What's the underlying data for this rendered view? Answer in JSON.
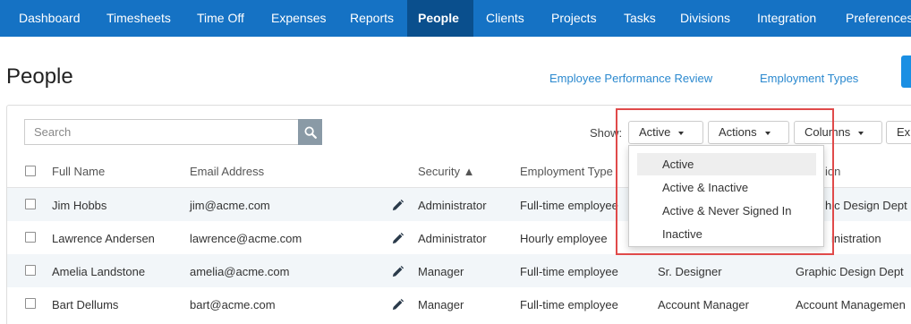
{
  "nav": {
    "items": [
      {
        "label": "Dashboard"
      },
      {
        "label": "Timesheets"
      },
      {
        "label": "Time Off"
      },
      {
        "label": "Expenses"
      },
      {
        "label": "Reports"
      },
      {
        "label": "People"
      },
      {
        "label": "Clients"
      },
      {
        "label": "Projects"
      },
      {
        "label": "Tasks"
      },
      {
        "label": "Divisions"
      },
      {
        "label": "Integration"
      },
      {
        "label": "Preferences"
      }
    ],
    "active": "People"
  },
  "header": {
    "title": "People",
    "links": [
      {
        "label": "Employee Performance Review"
      },
      {
        "label": "Employment Types"
      }
    ]
  },
  "toolbar": {
    "search_placeholder": "Search",
    "show_label": "Show:",
    "filter_value": "Active",
    "actions_label": "Actions",
    "columns_label": "Columns",
    "export_label": "Ex"
  },
  "filter_menu": {
    "options": [
      "Active",
      "Active & Inactive",
      "Active & Never Signed In",
      "Inactive"
    ],
    "selected": "Active"
  },
  "table": {
    "columns": {
      "full_name": "Full Name",
      "email": "Email Address",
      "security": "Security ▲",
      "employment_type": "Employment Type",
      "division_partial": "ion"
    },
    "rows": [
      {
        "name": "Jim Hobbs",
        "email": "jim@acme.com",
        "security": "Administrator",
        "employment_type": "Full-time employee",
        "title": "",
        "division": "hic Design Dept"
      },
      {
        "name": "Lawrence Andersen",
        "email": "lawrence@acme.com",
        "security": "Administrator",
        "employment_type": "Hourly employee",
        "title": "",
        "division": "inistration"
      },
      {
        "name": "Amelia Landstone",
        "email": "amelia@acme.com",
        "security": "Manager",
        "employment_type": "Full-time employee",
        "title": "Sr. Designer",
        "division": "Graphic Design Dept"
      },
      {
        "name": "Bart Dellums",
        "email": "bart@acme.com",
        "security": "Manager",
        "employment_type": "Full-time employee",
        "title": "Account Manager",
        "division": "Account Managemen"
      }
    ]
  },
  "colors": {
    "nav_bg": "#1572c4",
    "nav_active_bg": "#0a4f8d",
    "link": "#2b89cf",
    "highlight": "#e04a4a"
  }
}
